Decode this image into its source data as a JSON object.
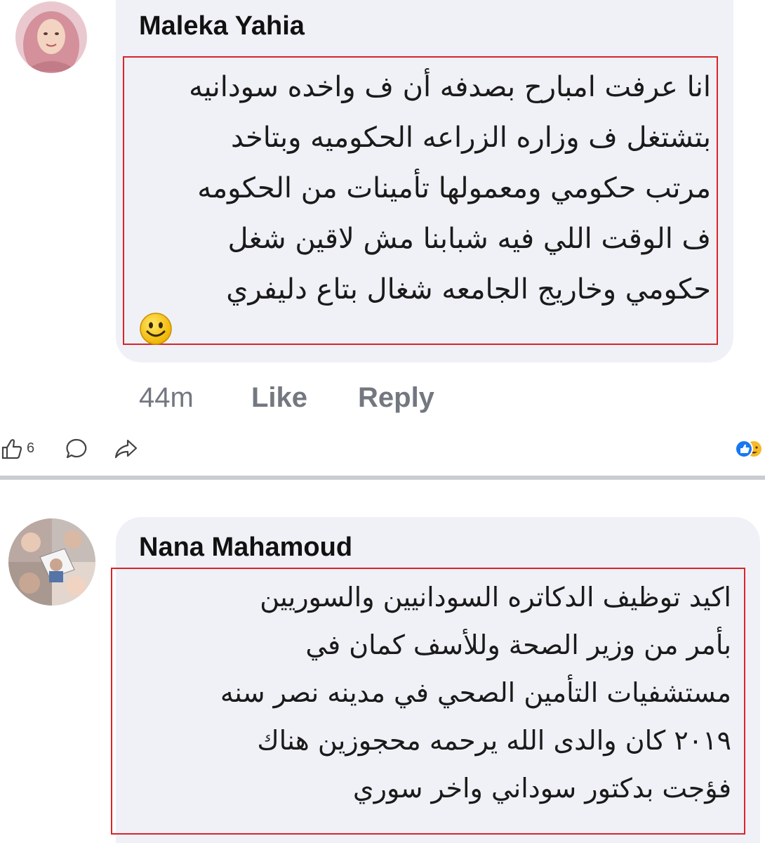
{
  "comment1": {
    "author": "Maleka Yahia",
    "text": "انا عرفت امبارح بصدفه أن ف واخده سودانيه\nبتشتغل ف وزاره الزراعه الحكوميه وبتاخد\nمرتب حكومي ومعمولها تأمينات من الحكومه\nف الوقت اللي فيه شبابنا مش لاقين شغل\nحكومي وخاريج الجامعه شغال بتاع دليفري",
    "emoji": "smiley-emoji",
    "timestamp": "44m",
    "like_label": "Like",
    "reply_label": "Reply"
  },
  "post_footer": {
    "like_count": "6",
    "icons": [
      "thumbs-up-icon",
      "comment-icon",
      "share-icon",
      "reactions-icon"
    ],
    "colors": {
      "like_reaction": "#1877f2",
      "haha_reaction": "#f7b928"
    }
  },
  "comment2": {
    "author": "Nana Mahamoud",
    "text": "اكيد توظيف الدكاتره السودانيين والسوريين\nبأمر من وزير الصحة وللأسف كمان في\nمستشفيات التأمين الصحي في مدينه نصر سنه\n٢٠١٩ كان والدى  الله يرحمه محجوزين هناك\nفؤجت بدكتور سوداني واخر سوري"
  },
  "colors": {
    "bubble": "#eff1f6",
    "highlight_border": "#d9242b",
    "action_text": "#737780"
  }
}
